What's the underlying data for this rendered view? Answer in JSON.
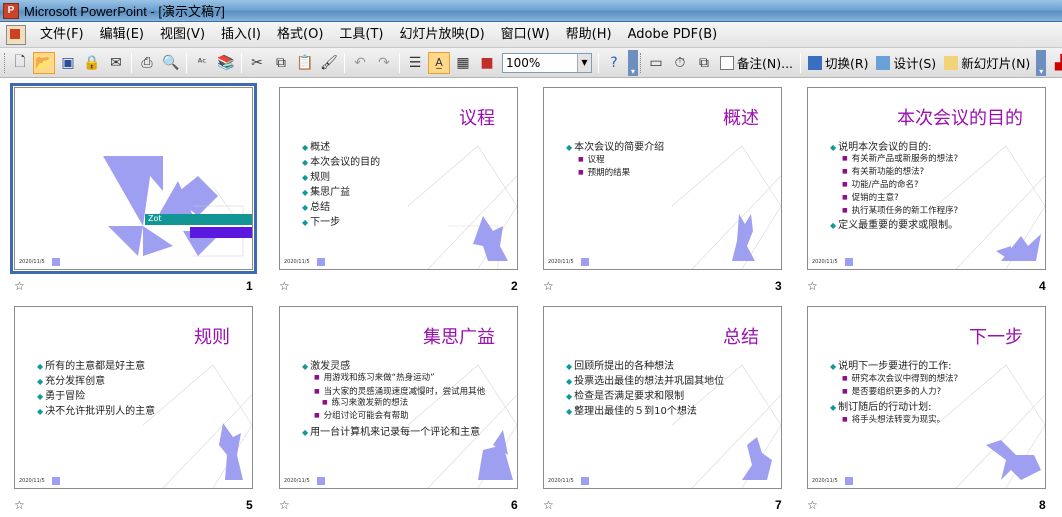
{
  "window": {
    "title": "Microsoft PowerPoint - [演示文稿7]"
  },
  "menu": {
    "items": [
      "文件(F)",
      "编辑(E)",
      "视图(V)",
      "插入(I)",
      "格式(O)",
      "工具(T)",
      "幻灯片放映(D)",
      "窗口(W)",
      "帮助(H)",
      "Adobe PDF(B)"
    ]
  },
  "toolbar": {
    "zoom": "100%",
    "notes_label": "备注(N)...",
    "transition_label": "切换(R)",
    "design_label": "设计(S)",
    "new_slide_label": "新幻灯片(N)"
  },
  "slides": [
    {
      "number": "1",
      "title": "",
      "date": "2020/11/5",
      "banner_text": "Zot",
      "bullets": []
    },
    {
      "number": "2",
      "title": "议程",
      "date": "2020/11/5",
      "bullets": [
        {
          "text": "概述",
          "level": 1
        },
        {
          "text": "本次会议的目的",
          "level": 1
        },
        {
          "text": "规则",
          "level": 1
        },
        {
          "text": "集思广益",
          "level": 1
        },
        {
          "text": "总结",
          "level": 1
        },
        {
          "text": "下一步",
          "level": 1
        }
      ]
    },
    {
      "number": "3",
      "title": "概述",
      "date": "2020/11/5",
      "bullets": [
        {
          "text": "本次会议的简要介绍",
          "level": 1
        },
        {
          "text": "议程",
          "level": 2
        },
        {
          "text": "预期的结果",
          "level": 2
        }
      ]
    },
    {
      "number": "4",
      "title": "本次会议的目的",
      "date": "2020/11/5",
      "bullets": [
        {
          "text": "说明本次会议的目的:",
          "level": 1
        },
        {
          "text": "有关新产品或新服务的想法?",
          "level": 2
        },
        {
          "text": "有关新功能的想法?",
          "level": 2
        },
        {
          "text": "功能/产品的命名?",
          "level": 2
        },
        {
          "text": "促销的主意?",
          "level": 2
        },
        {
          "text": "执行某项任务的新工作程序?",
          "level": 2
        },
        {
          "text": "定义最重要的要求或限制。",
          "level": 1
        }
      ]
    },
    {
      "number": "5",
      "title": "规则",
      "date": "2020/11/5",
      "bullets": [
        {
          "text": "所有的主意都是好主意",
          "level": 1
        },
        {
          "text": "充分发挥创意",
          "level": 1
        },
        {
          "text": "勇于冒险",
          "level": 1
        },
        {
          "text": "决不允许批评别人的主意",
          "level": 1
        }
      ]
    },
    {
      "number": "6",
      "title": "集思广益",
      "date": "2020/11/5",
      "bullets": [
        {
          "text": "激发灵感",
          "level": 1
        },
        {
          "text": "用游戏和练习来做“热身运动”",
          "level": 2
        },
        {
          "text": "当大家的灵感涌现速度减慢时，尝试用其他",
          "level": 2
        },
        {
          "text": "练习来激发新的想法",
          "level": 2
        },
        {
          "text": "分组讨论可能会有帮助",
          "level": 2
        },
        {
          "text": "用一台计算机来记录每一个评论和主意",
          "level": 1
        }
      ]
    },
    {
      "number": "7",
      "title": "总结",
      "date": "2020/11/5",
      "bullets": [
        {
          "text": "回顾所提出的各种想法",
          "level": 1
        },
        {
          "text": "投票选出最佳的想法并巩固其地位",
          "level": 1
        },
        {
          "text": "检查是否满足要求和限制",
          "level": 1
        },
        {
          "text": "整理出最佳的５到10个想法",
          "level": 1
        }
      ]
    },
    {
      "number": "8",
      "title": "下一步",
      "date": "2020/11/5",
      "bullets": [
        {
          "text": "说明下一步要进行的工作:",
          "level": 1
        },
        {
          "text": "研究本次会议中得到的想法?",
          "level": 2
        },
        {
          "text": "是否要组织更多的人力?",
          "level": 2
        },
        {
          "text": "制订随后的行动计划:",
          "level": 1
        },
        {
          "text": "将手头想法转变为现实。",
          "level": 2
        }
      ]
    }
  ],
  "colors": {
    "accent_purple": "#9a10b0",
    "bullet_teal": "#11999a",
    "tangram": "#9f9ff2",
    "selection": "#3d6bb3"
  }
}
